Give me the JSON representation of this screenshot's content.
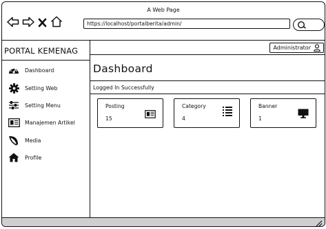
{
  "window": {
    "title": "A Web Page",
    "url": "https://localhost/portalberita/admin/"
  },
  "sidebar": {
    "title": "PORTAL KEMENAG",
    "items": [
      {
        "label": "Dashboard",
        "icon": "dashboard-gauge-icon"
      },
      {
        "label": "Setting Web",
        "icon": "gear-icon"
      },
      {
        "label": "Setting Menu",
        "icon": "sliders-icon"
      },
      {
        "label": "Manajemen Artikel",
        "icon": "newspaper-icon"
      },
      {
        "label": "Media",
        "icon": "leaf-icon"
      },
      {
        "label": "Profile",
        "icon": "home-icon"
      }
    ]
  },
  "header": {
    "user_label": "Administrator",
    "user_icon": "user-icon"
  },
  "main": {
    "title": "Dashboard",
    "alert": "Logged In Successfully",
    "cards": [
      {
        "label": "Posting",
        "value": "15",
        "icon": "newspaper-icon"
      },
      {
        "label": "Category",
        "value": "4",
        "icon": "list-icon"
      },
      {
        "label": "Banner",
        "value": "1",
        "icon": "monitor-icon"
      }
    ]
  }
}
